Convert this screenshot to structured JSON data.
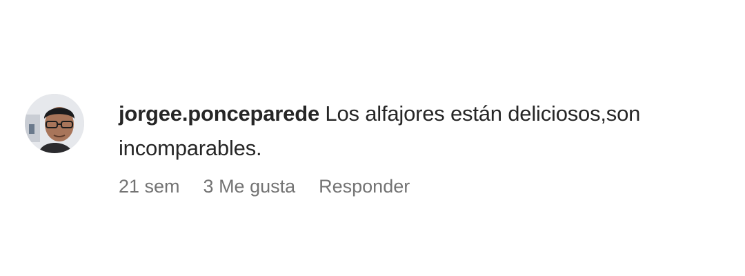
{
  "comment": {
    "avatar_icon": "profile-photo",
    "username": "jorgee.ponceparede",
    "text": "Los alfajores están deliciosos,son incomparables.",
    "time": "21 sem",
    "likes": "3 Me gusta",
    "reply_label": "Responder"
  }
}
